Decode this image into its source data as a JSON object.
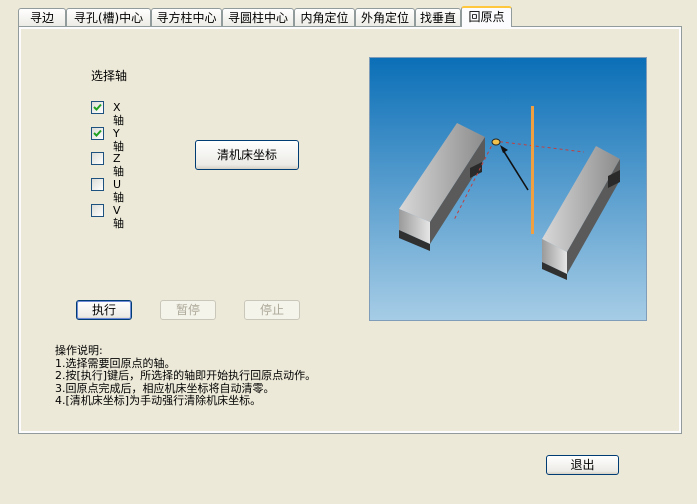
{
  "tabs": [
    "寻边",
    "寻孔(槽)中心",
    "寻方柱中心",
    "寻圆柱中心",
    "内角定位",
    "外角定位",
    "找垂直",
    "回原点"
  ],
  "active_tab": 7,
  "section_title": "选择轴",
  "axes": [
    {
      "label": "X轴",
      "checked": true
    },
    {
      "label": "Y轴",
      "checked": true
    },
    {
      "label": "Z轴",
      "checked": false
    },
    {
      "label": "U轴",
      "checked": false
    },
    {
      "label": "V轴",
      "checked": false
    }
  ],
  "clear_button": "清机床坐标",
  "buttons": {
    "execute": "执行",
    "pause": "暂停",
    "stop": "停止",
    "exit": "退出"
  },
  "help": {
    "title": "操作说明:",
    "lines": [
      "1.选择需要回原点的轴。",
      "2.按[执行]键后，所选择的轴即开始执行回原点动作。",
      "3.回原点完成后，相应机床坐标将自动清零。",
      "4.[清机床坐标]为手动强行清除机床坐标。"
    ]
  },
  "colors": {
    "accent_tab": "#ffc83c",
    "button_border": "#003c74",
    "check": "#21a121"
  }
}
